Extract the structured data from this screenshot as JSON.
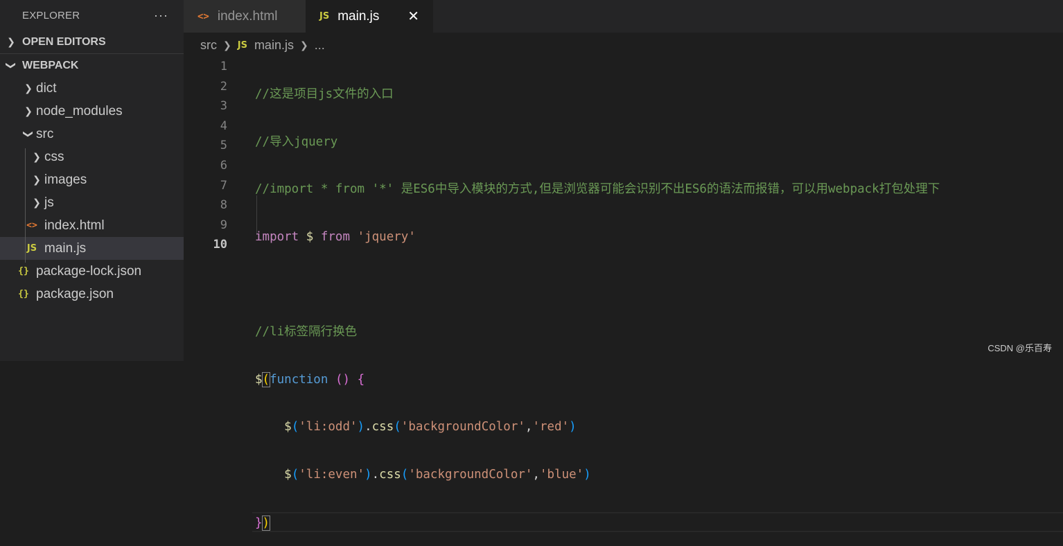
{
  "sidebar": {
    "title": "EXPLORER",
    "more": "···",
    "open_editors": "OPEN EDITORS",
    "project": "WEBPACK",
    "tree": {
      "dict": "dict",
      "node_modules": "node_modules",
      "src": "src",
      "css": "css",
      "images": "images",
      "js": "js",
      "index_html": "index.html",
      "main_js": "main.js",
      "package_lock": "package-lock.json",
      "package_json": "package.json"
    },
    "badges": {
      "js": "JS",
      "html": "<>",
      "json": "{}"
    }
  },
  "tabs": [
    {
      "label": "index.html",
      "icon": "html-file-icon"
    },
    {
      "label": "main.js",
      "icon": "js-file-icon",
      "close": "✕"
    }
  ],
  "breadcrumb": {
    "folder": "src",
    "file": "main.js",
    "more": "..."
  },
  "line_numbers": [
    "1",
    "2",
    "3",
    "4",
    "5",
    "6",
    "7",
    "8",
    "9",
    "10"
  ],
  "code": {
    "l1": "//这是项目js文件的入口",
    "l2": "//导入jquery",
    "l3": "//import * from '*' 是ES6中导入模块的方式,但是浏览器可能会识别不出ES6的语法而报错，可以用webpack打包处理下",
    "l4_import": "import",
    "l4_dollar": "$",
    "l4_from": "from",
    "l4_str": "'jquery'",
    "l6": "//li标签隔行换色",
    "l7_dollar": "$",
    "l7_open": "(",
    "l7_function": "function",
    "l7_parens": "()",
    "l7_brace": "{",
    "l8_dollar": "$",
    "l8_sel": "'li:odd'",
    "l8_css": "css",
    "l8_prop": "'backgroundColor'",
    "l8_val": "'red'",
    "l9_dollar": "$",
    "l9_sel": "'li:even'",
    "l9_css": "css",
    "l9_prop": "'backgroundColor'",
    "l9_val": "'blue'",
    "l10_brace": "}",
    "l10_close": ")"
  },
  "watermark": "CSDN @乐百寿",
  "colors": {
    "comment": "#6a9955",
    "keyword": "#c586c0",
    "string": "#ce9178",
    "js_badge": "#cbcb41",
    "html_badge": "#e37933"
  }
}
